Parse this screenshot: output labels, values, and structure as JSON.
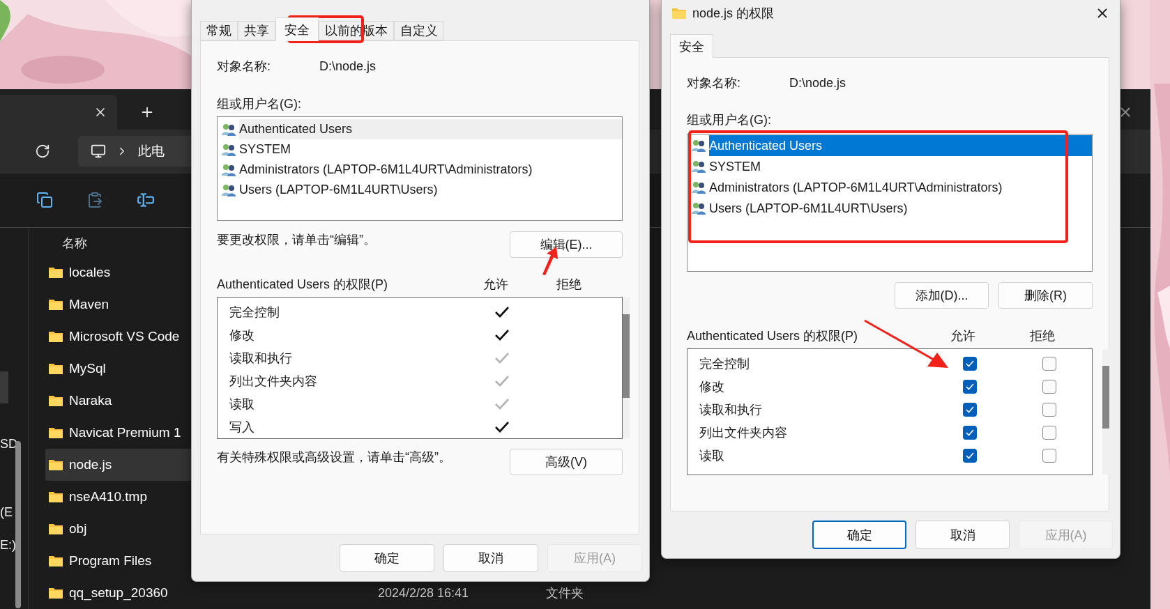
{
  "explorer": {
    "breadcrumb": "此电",
    "column_header": "名称",
    "nav_fragments": [
      "SD",
      "(E",
      "E:)"
    ],
    "files": [
      {
        "name": "locales",
        "selected": false
      },
      {
        "name": "Maven",
        "selected": false
      },
      {
        "name": "Microsoft VS Code",
        "selected": false
      },
      {
        "name": "MySql",
        "selected": false
      },
      {
        "name": "Naraka",
        "selected": false
      },
      {
        "name": "Navicat Premium 1",
        "selected": false
      },
      {
        "name": "node.js",
        "selected": true
      },
      {
        "name": "nseA410.tmp",
        "selected": false
      },
      {
        "name": "obj",
        "selected": false
      },
      {
        "name": "Program Files",
        "selected": false
      },
      {
        "name": "qq_setup_20360",
        "selected": false,
        "date": "2024/2/28 16:41",
        "type": "文件夹"
      }
    ]
  },
  "properties_dialog": {
    "tabs": [
      {
        "label": "常规",
        "selected": false
      },
      {
        "label": "共享",
        "selected": false
      },
      {
        "label": "安全",
        "selected": true
      },
      {
        "label": "以前的版本",
        "selected": false
      },
      {
        "label": "自定义",
        "selected": false
      }
    ],
    "object_label": "对象名称:",
    "object_value": "D:\\node.js",
    "group_label": "组或用户名(G):",
    "list_focused": false,
    "users": [
      {
        "name": "Authenticated Users",
        "selected": true
      },
      {
        "name": "SYSTEM",
        "selected": false
      },
      {
        "name": "Administrators (LAPTOP-6M1L4URT\\Administrators)",
        "selected": false
      },
      {
        "name": "Users (LAPTOP-6M1L4URT\\Users)",
        "selected": false
      }
    ],
    "edit_hint": "要更改权限，请单击“编辑”。",
    "edit_button": "编辑(E)...",
    "perm_label": "Authenticated Users 的权限(P)",
    "allow_header": "允许",
    "deny_header": "拒绝",
    "permissions": [
      {
        "name": "完全控制",
        "allow": true,
        "inherited": false
      },
      {
        "name": "修改",
        "allow": true,
        "inherited": false
      },
      {
        "name": "读取和执行",
        "allow": true,
        "inherited": true
      },
      {
        "name": "列出文件夹内容",
        "allow": true,
        "inherited": true
      },
      {
        "name": "读取",
        "allow": true,
        "inherited": true
      },
      {
        "name": "写入",
        "allow": true,
        "inherited": false
      }
    ],
    "advanced_hint": "有关特殊权限或高级设置，请单击“高级”。",
    "advanced_button": "高级(V)",
    "buttons": [
      {
        "label": "确定",
        "disabled": false,
        "default": false
      },
      {
        "label": "取消",
        "disabled": false,
        "default": false
      },
      {
        "label": "应用(A)",
        "disabled": true,
        "default": false
      }
    ]
  },
  "permissions_dialog": {
    "title": "node.js 的权限",
    "tabs": [
      {
        "label": "安全",
        "selected": true
      }
    ],
    "object_label": "对象名称:",
    "object_value": "D:\\node.js",
    "group_label": "组或用户名(G):",
    "list_focused": true,
    "users": [
      {
        "name": "Authenticated Users",
        "selected": true
      },
      {
        "name": "SYSTEM",
        "selected": false
      },
      {
        "name": "Administrators (LAPTOP-6M1L4URT\\Administrators)",
        "selected": false
      },
      {
        "name": "Users (LAPTOP-6M1L4URT\\Users)",
        "selected": false
      }
    ],
    "add_button": "添加(D)...",
    "remove_button": "删除(R)",
    "perm_label": "Authenticated Users 的权限(P)",
    "allow_header": "允许",
    "deny_header": "拒绝",
    "permissions": [
      {
        "name": "完全控制",
        "allow": true,
        "deny": false
      },
      {
        "name": "修改",
        "allow": true,
        "deny": false
      },
      {
        "name": "读取和执行",
        "allow": true,
        "deny": false
      },
      {
        "name": "列出文件夹内容",
        "allow": true,
        "deny": false
      },
      {
        "name": "读取",
        "allow": true,
        "deny": false
      }
    ],
    "buttons": [
      {
        "label": "确定",
        "disabled": false,
        "default": true
      },
      {
        "label": "取消",
        "disabled": false,
        "default": false
      },
      {
        "label": "应用(A)",
        "disabled": true,
        "default": false
      }
    ]
  }
}
